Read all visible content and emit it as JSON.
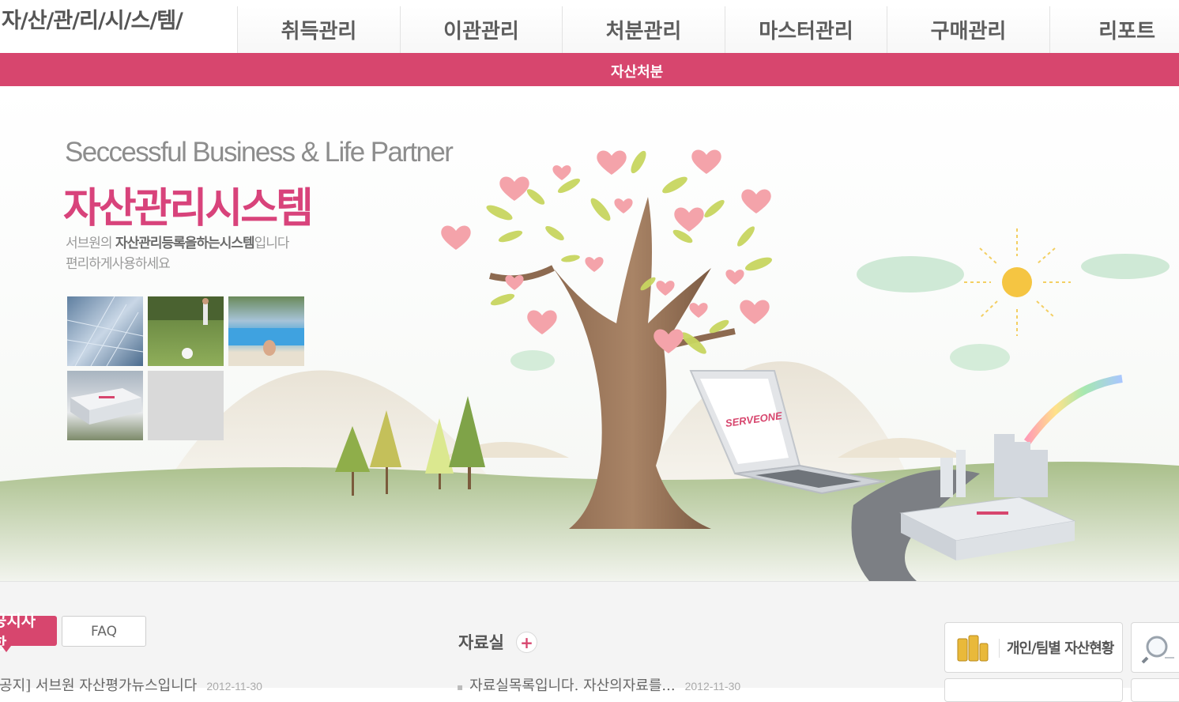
{
  "header": {
    "logo": "자/산/관/리/시/스/템/",
    "nav": [
      "취득관리",
      "이관관리",
      "처분관리",
      "마스터관리",
      "구매관리",
      "리포트"
    ],
    "subnav": "자산처분"
  },
  "hero": {
    "tagline": "Seccessful Business & Life Partner",
    "title": "자산관리시스템",
    "desc_line1_pre": "서브원의 ",
    "desc_line1_bold": "자산관리등록을하는시스템",
    "desc_line1_post": "입니다",
    "desc_line2": "편리하게사용하세요",
    "laptop_brand": "SERVEONE"
  },
  "notice": {
    "tab_active": "공지사항",
    "tab_faq": "FAQ",
    "item_text": "[공지] 서브원 자산평가뉴스입니다",
    "item_date": "2012-11-30"
  },
  "pds": {
    "title": "자료실",
    "plus": "+",
    "item_text": "자료실목록입니다. 자산의자료를...",
    "item_date": "2012-11-30"
  },
  "quick": {
    "asset_status": "개인/팀별 자산현황"
  },
  "colors": {
    "accent": "#d7466e",
    "nav_text": "#5d5d5d"
  }
}
